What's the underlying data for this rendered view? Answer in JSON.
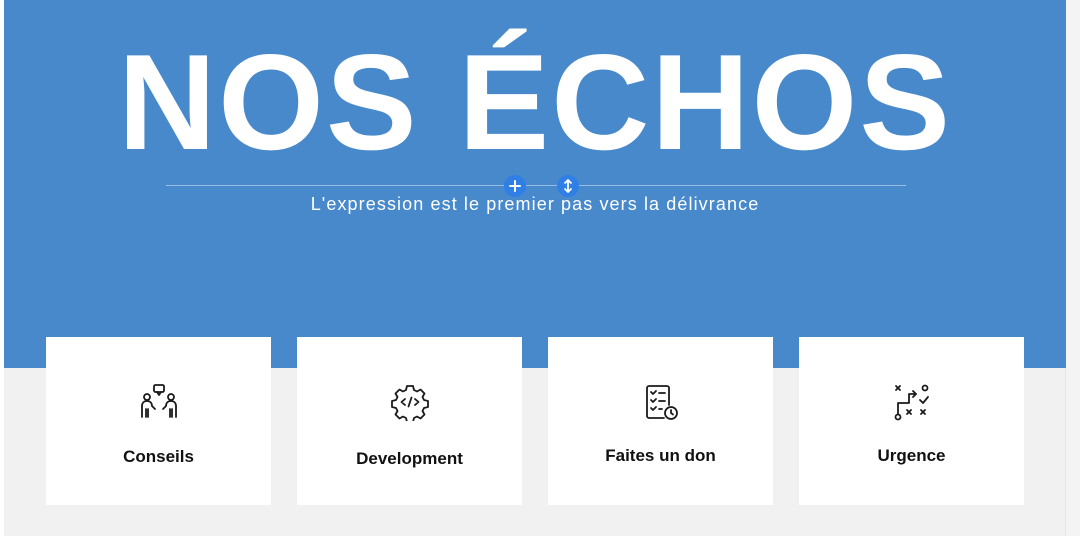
{
  "hero": {
    "title": "NOS ÉCHOS",
    "subtitle": "L'expression est le premier pas vers la délivrance",
    "background_color": "#4789cb"
  },
  "editor_controls": {
    "add_icon": "plus-icon",
    "resize_icon": "resize-vertical-icon",
    "accent_color": "#2f7fe6"
  },
  "cards": [
    {
      "label": "Conseils",
      "icon": "people-chat-icon"
    },
    {
      "label": "Development",
      "icon": "gear-code-icon"
    },
    {
      "label": "Faites un don",
      "icon": "checklist-clock-icon"
    },
    {
      "label": "Urgence",
      "icon": "strategy-map-icon"
    }
  ]
}
